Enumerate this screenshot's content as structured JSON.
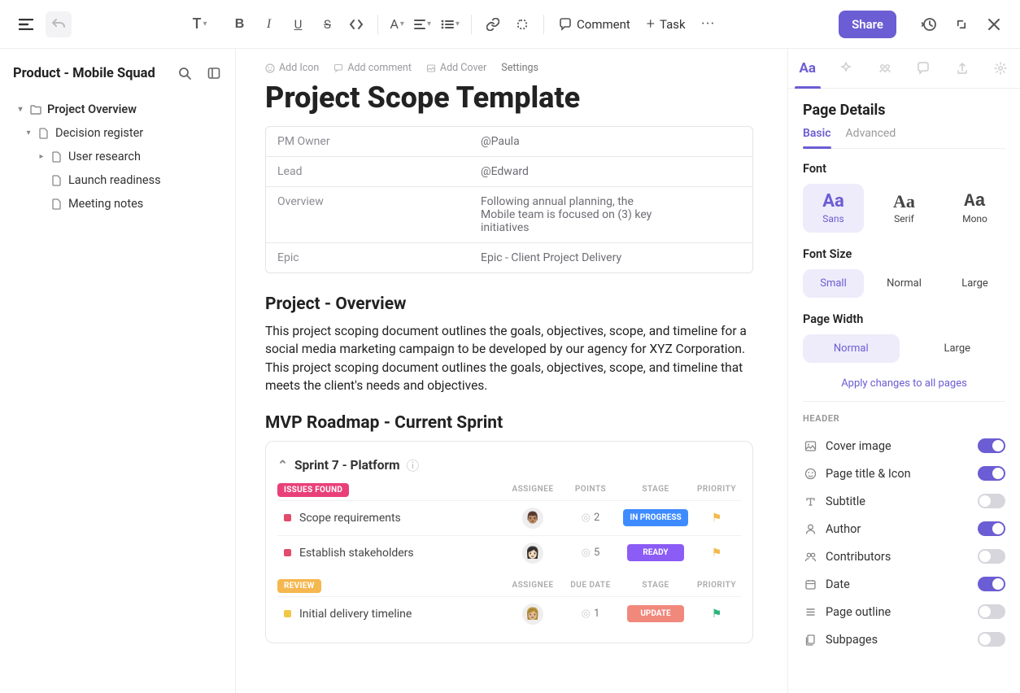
{
  "topbar": {
    "comment": "Comment",
    "task": "Task",
    "share": "Share",
    "text_menu": "T"
  },
  "sidebar": {
    "title": "Product - Mobile Squad",
    "tree": [
      {
        "label": "Project Overview",
        "bold": true
      },
      {
        "label": "Decision register"
      },
      {
        "label": "User research"
      },
      {
        "label": "Launch readiness"
      },
      {
        "label": "Meeting notes"
      }
    ]
  },
  "meta": {
    "add_icon": "Add Icon",
    "add_comment": "Add comment",
    "add_cover": "Add Cover",
    "settings": "Settings"
  },
  "doc": {
    "title": "Project Scope Template",
    "info": [
      {
        "key": "PM Owner",
        "val": "@Paula"
      },
      {
        "key": "Lead",
        "val": "@Edward"
      },
      {
        "key": "Overview",
        "val": "Following annual planning, the Mobile team is focused on (3) key initiatives"
      },
      {
        "key": "Epic",
        "val": "Epic - Client Project Delivery"
      }
    ],
    "h2a": "Project - Overview",
    "para": "This project scoping document outlines the goals, objectives, scope, and timeline for a social media marketing campaign to be developed by our agency for XYZ Corporation. This project scoping document outlines the goals, objectives, scope, and timeline that meets the client's needs and objectives.",
    "h2b": "MVP Roadmap - Current Sprint"
  },
  "board": {
    "title": "Sprint  7 - Platform",
    "sections": [
      {
        "tag": "ISSUES FOUND",
        "tag_class": "pink",
        "cols": [
          "ASSIGNEE",
          "POINTS",
          "STAGE",
          "PRIORITY"
        ],
        "rows": [
          {
            "name": "Scope requirements",
            "sq": "red",
            "avatar": "👨🏽",
            "points": "2",
            "stage": "IN PROGRESS",
            "stage_class": "blue",
            "flag": "yellow"
          },
          {
            "name": "Establish stakeholders",
            "sq": "red",
            "avatar": "👩🏻",
            "points": "5",
            "stage": "READY",
            "stage_class": "purple",
            "flag": "yellow"
          }
        ]
      },
      {
        "tag": "REVIEW",
        "tag_class": "orange",
        "cols": [
          "ASSIGNEE",
          "DUE DATE",
          "STAGE",
          "PRIORITY"
        ],
        "rows": [
          {
            "name": "Initial delivery timeline",
            "sq": "yellow",
            "avatar": "👩🏼",
            "points": "1",
            "stage": "UPDATE",
            "stage_class": "coral",
            "flag": "green"
          }
        ]
      }
    ]
  },
  "rpanel": {
    "title": "Page Details",
    "tabs": {
      "basic": "Basic",
      "advanced": "Advanced"
    },
    "font_label": "Font",
    "fonts": [
      {
        "name": "Sans",
        "active": true
      },
      {
        "name": "Serif"
      },
      {
        "name": "Mono"
      }
    ],
    "size_label": "Font Size",
    "sizes": [
      {
        "name": "Small",
        "active": true
      },
      {
        "name": "Normal"
      },
      {
        "name": "Large"
      }
    ],
    "width_label": "Page Width",
    "widths": [
      {
        "name": "Normal",
        "active": true
      },
      {
        "name": "Large"
      }
    ],
    "apply": "Apply changes to all pages",
    "header_label": "HEADER",
    "toggles": [
      {
        "label": "Cover image",
        "on": true,
        "icon": "image"
      },
      {
        "label": "Page title & Icon",
        "on": true,
        "icon": "smile"
      },
      {
        "label": "Subtitle",
        "on": false,
        "icon": "text"
      },
      {
        "label": "Author",
        "on": true,
        "icon": "user"
      },
      {
        "label": "Contributors",
        "on": false,
        "icon": "users"
      },
      {
        "label": "Date",
        "on": true,
        "icon": "calendar"
      },
      {
        "label": "Page outline",
        "on": false,
        "icon": "list"
      },
      {
        "label": "Subpages",
        "on": false,
        "icon": "pages"
      }
    ]
  }
}
